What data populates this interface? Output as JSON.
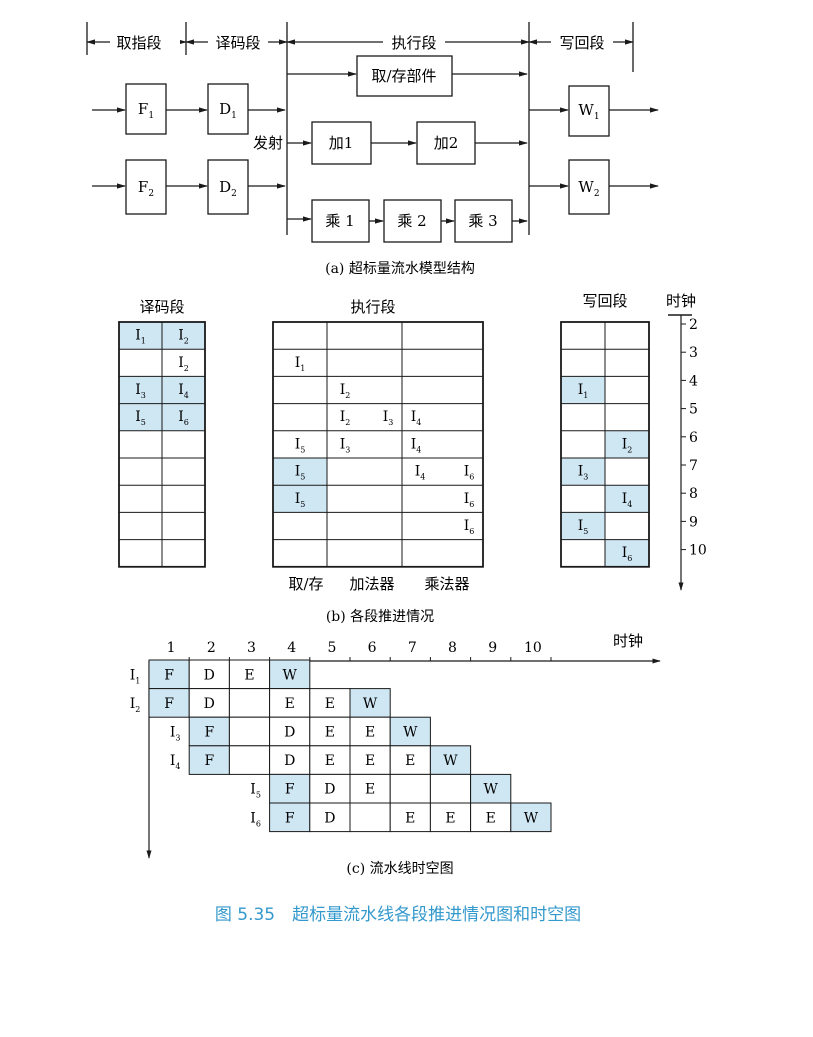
{
  "colors": {
    "highlight": "#cfe6f3",
    "ink": "#1a1a1a",
    "caption": "#3399cc"
  },
  "part_a": {
    "stages": [
      "取指段",
      "译码段",
      "执行段",
      "写回段"
    ],
    "issue_label": "发射",
    "fetch": [
      {
        "b": "F",
        "s": "1"
      },
      {
        "b": "F",
        "s": "2"
      }
    ],
    "decode": [
      {
        "b": "D",
        "s": "1"
      },
      {
        "b": "D",
        "s": "2"
      }
    ],
    "loadstore": "取/存部件",
    "adders": [
      "加1",
      "加2"
    ],
    "multipliers": [
      "乘 1",
      "乘 2",
      "乘 3"
    ],
    "writeback": [
      {
        "b": "W",
        "s": "1"
      },
      {
        "b": "W",
        "s": "2"
      }
    ],
    "caption": "(a) 超标量流水模型结构"
  },
  "part_b": {
    "decode_title": "译码段",
    "exec_title": "执行段",
    "wb_title": "写回段",
    "clock_title": "时钟",
    "clock_ticks": [
      "2",
      "3",
      "4",
      "5",
      "6",
      "7",
      "8",
      "9",
      "10"
    ],
    "decode_rows": [
      [
        {
          "b": "I",
          "s": "1",
          "hl": true
        },
        {
          "b": "I",
          "s": "2",
          "hl": true
        }
      ],
      [
        null,
        {
          "b": "I",
          "s": "2",
          "hl": false
        }
      ],
      [
        {
          "b": "I",
          "s": "3",
          "hl": true
        },
        {
          "b": "I",
          "s": "4",
          "hl": true
        }
      ],
      [
        {
          "b": "I",
          "s": "5",
          "hl": true
        },
        {
          "b": "I",
          "s": "6",
          "hl": true
        }
      ],
      [
        null,
        null
      ],
      [
        null,
        null
      ],
      [
        null,
        null
      ],
      [
        null,
        null
      ],
      [
        null,
        null
      ]
    ],
    "exec_rows": [
      [
        [],
        [],
        []
      ],
      [
        [
          {
            "b": "I",
            "s": "1"
          }
        ],
        [],
        []
      ],
      [
        [],
        [
          {
            "b": "I",
            "s": "2"
          }
        ],
        []
      ],
      [
        [],
        [
          {
            "b": "I",
            "s": "2"
          },
          {
            "b": "I",
            "s": "3"
          }
        ],
        [
          {
            "b": "I",
            "s": "4"
          }
        ]
      ],
      [
        [
          {
            "b": "I",
            "s": "5"
          }
        ],
        [
          {
            "b": "I",
            "s": "3"
          }
        ],
        [
          {
            "b": "I",
            "s": "4"
          }
        ]
      ],
      [
        [
          {
            "b": "I",
            "s": "5",
            "hl": true
          }
        ],
        [],
        [
          {
            "b": "I",
            "s": "4"
          },
          {
            "b": "I",
            "s": "6"
          }
        ]
      ],
      [
        [
          {
            "b": "I",
            "s": "5",
            "hl": true
          }
        ],
        [],
        [
          {
            "b": "I",
            "s": "6"
          }
        ]
      ],
      [
        [],
        [],
        [
          {
            "b": "I",
            "s": "6"
          }
        ]
      ],
      [
        [],
        [],
        []
      ]
    ],
    "wb_rows": [
      [
        null,
        null
      ],
      [
        null,
        null
      ],
      [
        {
          "b": "I",
          "s": "1",
          "hl": true
        },
        null
      ],
      [
        null,
        null
      ],
      [
        null,
        {
          "b": "I",
          "s": "2",
          "hl": true
        }
      ],
      [
        {
          "b": "I",
          "s": "3",
          "hl": true
        },
        null
      ],
      [
        null,
        {
          "b": "I",
          "s": "4",
          "hl": true
        }
      ],
      [
        {
          "b": "I",
          "s": "5",
          "hl": true
        },
        null
      ],
      [
        null,
        {
          "b": "I",
          "s": "6",
          "hl": true
        }
      ]
    ],
    "exec_units": [
      "取/存",
      "加法器",
      "乘法器"
    ],
    "caption": "(b) 各段推进情况"
  },
  "part_c": {
    "clock_title": "时钟",
    "clocks": [
      "1",
      "2",
      "3",
      "4",
      "5",
      "6",
      "7",
      "8",
      "9",
      "10"
    ],
    "rows": [
      {
        "b": "I",
        "s": "1",
        "start": 0,
        "cells": [
          {
            "t": "F",
            "hl": true
          },
          {
            "t": "D",
            "hl": false
          },
          {
            "t": "E",
            "hl": false
          },
          {
            "t": "W",
            "hl": true
          }
        ]
      },
      {
        "b": "I",
        "s": "2",
        "start": 0,
        "cells": [
          {
            "t": "F",
            "hl": true
          },
          {
            "t": "D",
            "hl": false
          },
          {
            "t": "",
            "hl": false
          },
          {
            "t": "E",
            "hl": false
          },
          {
            "t": "E",
            "hl": false
          },
          {
            "t": "W",
            "hl": true
          }
        ]
      },
      {
        "b": "I",
        "s": "3",
        "start": 1,
        "cells": [
          {
            "t": "F",
            "hl": true
          },
          {
            "t": "",
            "hl": false
          },
          {
            "t": "D",
            "hl": false
          },
          {
            "t": "E",
            "hl": false
          },
          {
            "t": "E",
            "hl": false
          },
          {
            "t": "W",
            "hl": true
          }
        ]
      },
      {
        "b": "I",
        "s": "4",
        "start": 1,
        "cells": [
          {
            "t": "F",
            "hl": true
          },
          {
            "t": "",
            "hl": false
          },
          {
            "t": "D",
            "hl": false
          },
          {
            "t": "E",
            "hl": false
          },
          {
            "t": "E",
            "hl": false
          },
          {
            "t": "E",
            "hl": false
          },
          {
            "t": "W",
            "hl": true
          }
        ]
      },
      {
        "b": "I",
        "s": "5",
        "start": 3,
        "cells": [
          {
            "t": "F",
            "hl": true
          },
          {
            "t": "D",
            "hl": false
          },
          {
            "t": "E",
            "hl": false
          },
          {
            "t": "",
            "hl": false
          },
          {
            "t": "",
            "hl": false
          },
          {
            "t": "W",
            "hl": true
          }
        ]
      },
      {
        "b": "I",
        "s": "6",
        "start": 3,
        "cells": [
          {
            "t": "F",
            "hl": true
          },
          {
            "t": "D",
            "hl": false
          },
          {
            "t": "",
            "hl": false
          },
          {
            "t": "E",
            "hl": false
          },
          {
            "t": "E",
            "hl": false
          },
          {
            "t": "E",
            "hl": false
          },
          {
            "t": "W",
            "hl": true
          }
        ]
      }
    ],
    "caption": "(c) 流水线时空图"
  },
  "figure_caption": "图 5.35　超标量流水线各段推进情况图和时空图"
}
